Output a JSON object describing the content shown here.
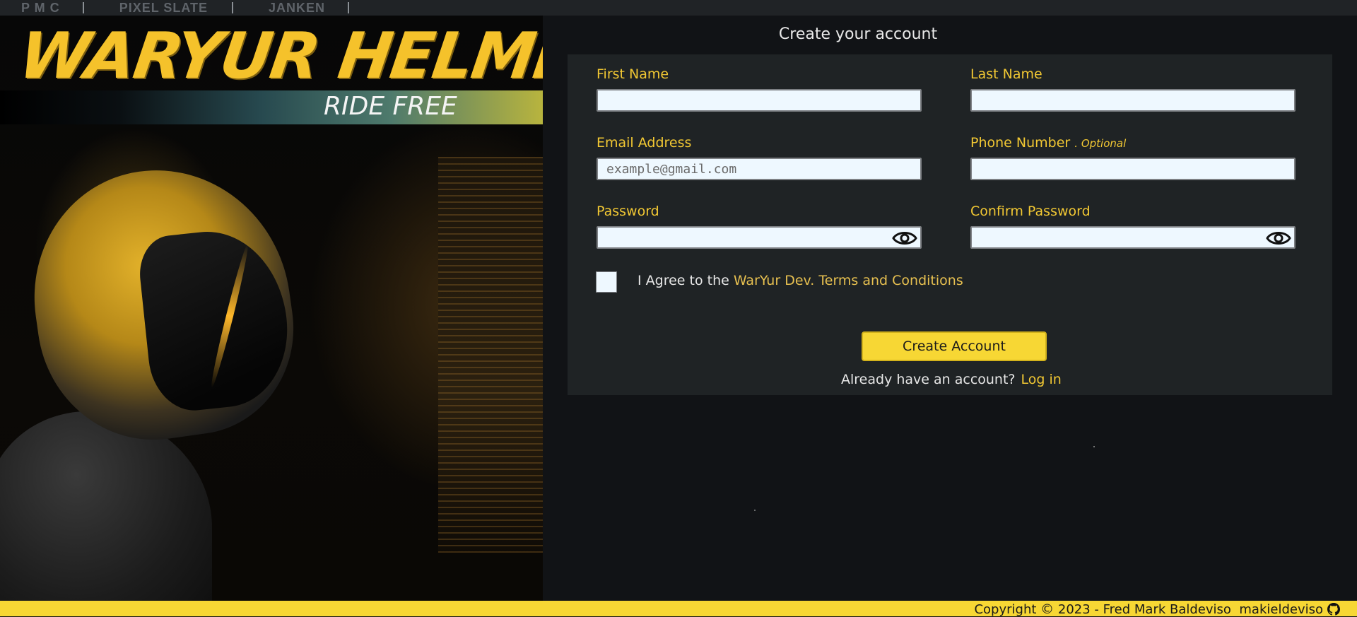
{
  "nav": {
    "items": [
      "P M C",
      "PIXEL SLATE",
      "JANKEN"
    ]
  },
  "hero": {
    "brand": "WARYUR HELMETS",
    "tagline": "RIDE FREE"
  },
  "form": {
    "heading": "Create your account",
    "first_name_label": "First Name",
    "last_name_label": "Last Name",
    "email_label": "Email Address",
    "email_placeholder": "example@gmail.com",
    "phone_label": "Phone Number",
    "phone_optional": ". Optional",
    "password_label": "Password",
    "confirm_password_label": "Confirm Password",
    "agree_text": "I Agree to the ",
    "terms_link": "WarYur Dev. Terms and Conditions",
    "submit_label": "Create Account",
    "already_text": "Already have an account?",
    "login_link": "Log in"
  },
  "footer": {
    "copyright": "Copyright",
    "copyright_symbol": "©",
    "year_author": "2023 - Fred Mark Baldeviso",
    "github_user": "makieldeviso"
  },
  "icons": {
    "password_toggle": "eye-icon",
    "confirm_password_toggle": "eye-icon",
    "github": "github-icon"
  },
  "colors": {
    "accent_yellow": "#f7d734",
    "label_yellow": "#f2c833",
    "card_bg": "#1f2325",
    "page_bg": "#111316"
  }
}
